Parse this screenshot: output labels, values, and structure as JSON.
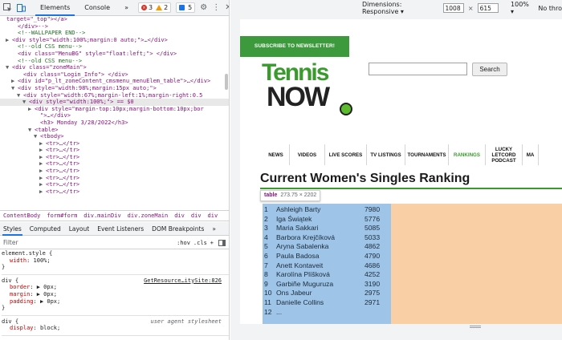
{
  "devtools": {
    "tabs": [
      "Elements",
      "Console"
    ],
    "more": "»",
    "counts": {
      "errors": "3",
      "warnings": "2",
      "info": "5"
    },
    "elements_lines": [
      {
        "indent": 0,
        "html": "target=\"_top\"></a>"
      },
      {
        "indent": 2,
        "html": "</div>-->"
      },
      {
        "indent": 2,
        "html": "<!--WALLPAPER END-->"
      },
      {
        "indent": 1,
        "arrow": "▶",
        "html": "<div style=\"width:100%;margin:0 auto;\">…</div>"
      },
      {
        "indent": 2,
        "html": "<!--old CSS menu-->"
      },
      {
        "indent": 2,
        "html": "<div class=\"MenuBG\" style=\"float:left;\"> </div>"
      },
      {
        "indent": 2,
        "html": "<!--old CSS menu-->"
      },
      {
        "indent": 1,
        "arrow": "▼",
        "html": "<div class=\"zoneMain\">"
      },
      {
        "indent": 3,
        "html": "<div class=\"Login_Info\"> </div>"
      },
      {
        "indent": 2,
        "arrow": "▶",
        "html": "<div id=\"p_lt_zoneContent_cmsmenu_menuElem_table\">…</div>"
      },
      {
        "indent": 2,
        "arrow": "▼",
        "html": "<div style=\"width:98%;margin:15px auto;\">"
      },
      {
        "indent": 3,
        "arrow": "▼",
        "html": "<div style=\"width:67%;margin-left:1%;margin-right:0.5"
      },
      {
        "indent": 4,
        "arrow": "▼",
        "html": "<div style=\"width:100%;\"> == $0",
        "selected": true
      },
      {
        "indent": 5,
        "arrow": "▶",
        "html": "<div style=\"margin-top:10px;margin-bottom:10px;bor"
      },
      {
        "indent": 6,
        "html": "\">…</div>"
      },
      {
        "indent": 6,
        "html": "<h3> Monday 3/28/2022</h3>"
      },
      {
        "indent": 5,
        "arrow": "▼",
        "html": "<table>"
      },
      {
        "indent": 6,
        "arrow": "▼",
        "html": "<tbody>"
      },
      {
        "indent": 7,
        "arrow": "▶",
        "html": "<tr>…</tr>"
      },
      {
        "indent": 7,
        "arrow": "▶",
        "html": "<tr>…</tr>"
      },
      {
        "indent": 7,
        "arrow": "▶",
        "html": "<tr>…</tr>"
      },
      {
        "indent": 7,
        "arrow": "▶",
        "html": "<tr>…</tr>"
      },
      {
        "indent": 7,
        "arrow": "▶",
        "html": "<tr>…</tr>"
      },
      {
        "indent": 7,
        "arrow": "▶",
        "html": "<tr>…</tr>"
      },
      {
        "indent": 7,
        "arrow": "▶",
        "html": "<tr>…</tr>"
      },
      {
        "indent": 7,
        "arrow": "▶",
        "html": "<tr>…</tr>"
      }
    ],
    "breadcrumbs": [
      "ContentBody",
      "form#form",
      "div.mainDiv",
      "div.zoneMain",
      "div",
      "div",
      "div"
    ],
    "style_tabs": [
      "Styles",
      "Computed",
      "Layout",
      "Event Listeners",
      "DOM Breakpoints",
      "»"
    ],
    "filter_placeholder": "Filter",
    "filter_tools": [
      ":hov",
      ".cls",
      "+"
    ],
    "styles_rules": [
      {
        "selector": "element.style {",
        "props": [
          {
            "name": "width",
            "value": "100%;"
          }
        ],
        "source": "",
        "close": "}"
      },
      {
        "selector": "div {",
        "props": [
          {
            "name": "border",
            "value": "▶ 0px;"
          },
          {
            "name": "margin",
            "value": "▶ 0px;"
          },
          {
            "name": "padding",
            "value": "▶ 0px;"
          }
        ],
        "source": "GetResource…itySite:826",
        "close": "}"
      },
      {
        "selector": "div {",
        "props": [
          {
            "name": "display",
            "value": "block;"
          }
        ],
        "source": "user agent stylesheet",
        "close": ""
      }
    ]
  },
  "device_toolbar": {
    "dimensions_label": "Dimensions: Responsive ▾",
    "width": "1008",
    "times": "×",
    "height": "615",
    "zoom": "100% ▾",
    "throttle": "No thro"
  },
  "site": {
    "subscribe_label": "SUBSCRIBE TO NEWSLETTER!",
    "logo_top": "Tennis",
    "logo_bottom": "NOW",
    "search_button": "Search",
    "nav": [
      {
        "label": "NEWS",
        "w": 34
      },
      {
        "label": "VIDEOS",
        "w": 44
      },
      {
        "label": "LIVE SCORES",
        "w": 52
      },
      {
        "label": "TV LISTINGS",
        "w": 48
      },
      {
        "label": "TOURNAMENTS",
        "w": 54
      },
      {
        "label": "RANKINGS",
        "w": 46,
        "active": true
      },
      {
        "label": "LUCKY LETCORD PODCAST",
        "w": 46
      },
      {
        "label": "MA",
        "w": 20
      }
    ],
    "page_title": "Current Women's Singles Ranking",
    "tooltip": {
      "tag": "table",
      "dims": "273.75 × 2202"
    },
    "rankings": [
      {
        "rank": "1",
        "name": "Ashleigh Barty",
        "points": "7980"
      },
      {
        "rank": "2",
        "name": "Iga Świątek",
        "points": "5776"
      },
      {
        "rank": "3",
        "name": "Maria Sakkari",
        "points": "5085"
      },
      {
        "rank": "4",
        "name": "Barbora Krejčíková",
        "points": "5033"
      },
      {
        "rank": "5",
        "name": "Aryna Sabalenka",
        "points": "4862"
      },
      {
        "rank": "6",
        "name": "Paula Badosa",
        "points": "4790"
      },
      {
        "rank": "7",
        "name": "Anett Kontaveit",
        "points": "4686"
      },
      {
        "rank": "8",
        "name": "Karolína Plíšková",
        "points": "4252"
      },
      {
        "rank": "9",
        "name": "Garbiñe Muguruza",
        "points": "3190"
      },
      {
        "rank": "10",
        "name": "Ons Jabeur",
        "points": "2975"
      },
      {
        "rank": "11",
        "name": "Danielle Collins",
        "points": "2971"
      },
      {
        "rank": "12",
        "name": "...",
        "points": ""
      }
    ]
  },
  "colors": {
    "green": "#3a9b2d",
    "highlight_content": "#9ec5e8",
    "highlight_padding": "#f8cb9c",
    "devtools_accent": "#1a73e8"
  }
}
